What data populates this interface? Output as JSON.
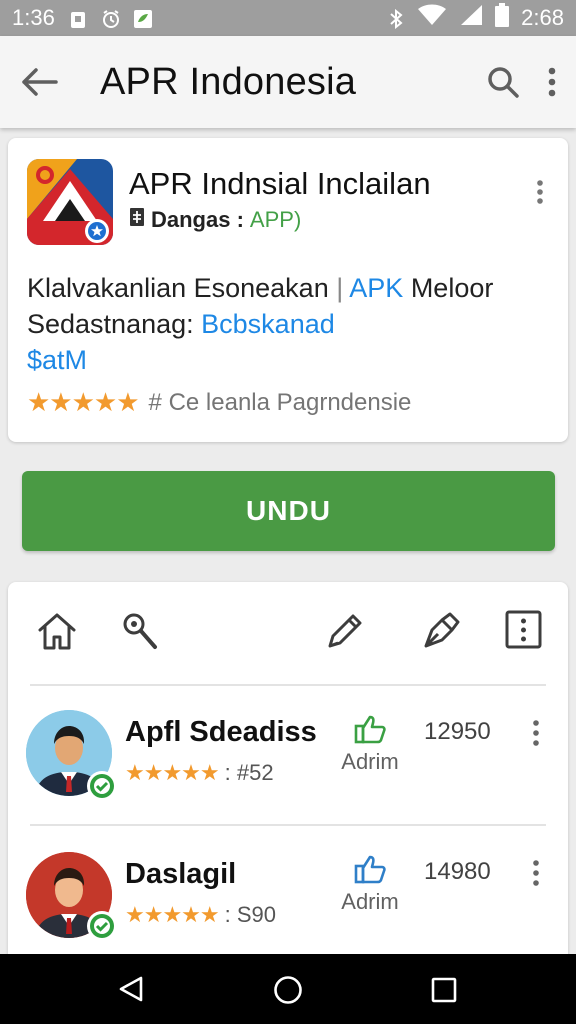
{
  "status_bar": {
    "time_left": "1:36",
    "time_right": "2:68",
    "icons": [
      "notification-icon",
      "alarm-icon",
      "app-notification-icon",
      "bluetooth-icon",
      "wifi-icon",
      "signal-icon",
      "battery-icon"
    ]
  },
  "app_bar": {
    "title": "APR Indonesia",
    "icons": [
      "back-arrow-icon",
      "search-icon",
      "more-vert-icon"
    ]
  },
  "app_card": {
    "name": "APR Indnsial Inclailan",
    "developer_label": "Dangas :",
    "developer_type": "APP)",
    "description_line1_a": "Klalvakanlian Esoneakan",
    "description_line1_sep": "|",
    "description_line1_b": "APK",
    "description_line1_c": "Meloor",
    "description_line2_a": "Sedastnanag:",
    "description_line2_b": "Bcbskanad",
    "price": "$atM",
    "stars": "★★★★★",
    "rating_value": 4.5,
    "rating_text": "# Ce leanla Pagrndensie"
  },
  "download_button": {
    "label": "UNDU"
  },
  "toolbar": {
    "icons": [
      "home-icon",
      "magnifier-icon",
      "pencil-icon",
      "pen-tip-icon",
      "more-box-icon"
    ]
  },
  "reviews": [
    {
      "name": "Apfl Sdeadiss",
      "stars": "★★★★★",
      "rating_label": ": #52",
      "like_label": "Adrim",
      "count": "12950"
    },
    {
      "name": "Daslagil",
      "stars": "★★★★★",
      "rating_label": ": S90",
      "like_label": "Adrim",
      "count": "14980"
    }
  ],
  "nav_bar": {
    "icons": [
      "back-triangle-icon",
      "home-circle-icon",
      "recents-square-icon"
    ]
  },
  "colors": {
    "accent_green": "#4a9a44",
    "star_orange": "#f29a2e",
    "link_blue": "#1e88e5",
    "status_bar": "#9e9e9e"
  }
}
